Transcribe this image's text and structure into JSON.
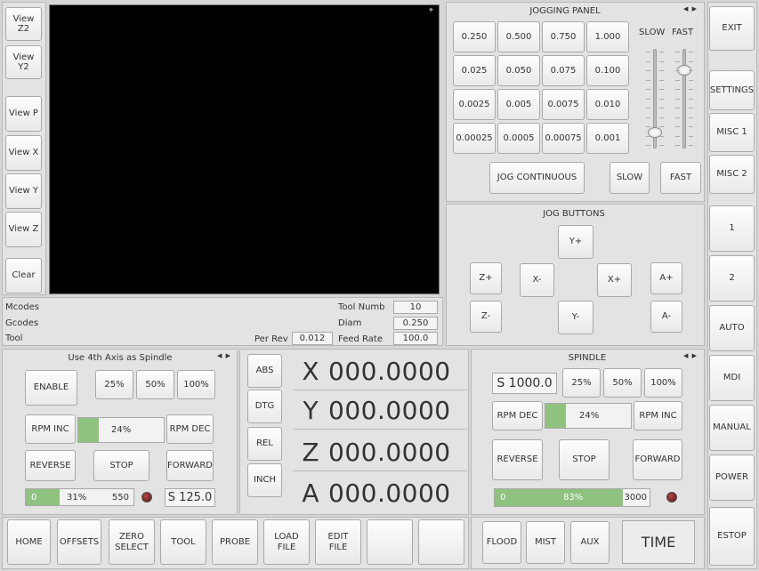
{
  "left_view_buttons": [
    "View Z2",
    "View Y2",
    "View P",
    "View X",
    "View Y",
    "View Z",
    "Clear"
  ],
  "info": {
    "mcodes_label": "Mcodes",
    "gcodes_label": "Gcodes",
    "tool_label": "Tool",
    "tool_numb_label": "Tool Numb",
    "tool_numb_value": "10",
    "diam_label": "Diam",
    "diam_value": "0.250",
    "per_rev_label": "Per Rev",
    "per_rev_value": "0.012",
    "feed_rate_label": "Feed Rate",
    "feed_rate_value": "100.0"
  },
  "jogging_panel": {
    "title": "JOGGING PANEL",
    "increments": [
      [
        "0.250",
        "0.500",
        "0.750",
        "1.000"
      ],
      [
        "0.025",
        "0.050",
        "0.075",
        "0.100"
      ],
      [
        "0.0025",
        "0.005",
        "0.0075",
        "0.010"
      ],
      [
        "0.00025",
        "0.0005",
        "0.00075",
        "0.001"
      ]
    ],
    "slow_label": "SLOW",
    "fast_label": "FAST",
    "slow_slider_level": 0.12,
    "fast_slider_level": 0.82,
    "jog_continuous": "JOG CONTINUOUS",
    "slow_btn": "SLOW",
    "fast_btn": "FAST"
  },
  "jog_buttons": {
    "title": "JOG BUTTONS",
    "y_plus": "Y+",
    "z_plus": "Z+",
    "x_minus": "X-",
    "x_plus": "X+",
    "a_plus": "A+",
    "z_minus": "Z-",
    "y_minus": "Y-",
    "a_minus": "A-"
  },
  "right_buttons": {
    "exit": "EXIT",
    "settings": "SETTINGS",
    "misc1": "MISC 1",
    "misc2": "MISC 2",
    "one": "1",
    "two": "2",
    "auto": "AUTO",
    "mdi": "MDI",
    "manual": "MANUAL",
    "power": "POWER",
    "estop": "ESTOP"
  },
  "fourth_axis": {
    "title": "Use 4th Axis as Spindle",
    "enable": "ENABLE",
    "p25": "25%",
    "p50": "50%",
    "p100": "100%",
    "rpm_inc": "RPM INC",
    "rpm_dec": "RPM DEC",
    "override_pct": "24%",
    "override_level": 0.24,
    "reverse": "REVERSE",
    "stop": "STOP",
    "forward": "FORWARD",
    "bar_min": "0",
    "bar_pct": "31%",
    "bar_level": 0.31,
    "bar_max": "550",
    "speed": "S 125.0"
  },
  "dro_mode_buttons": [
    "ABS",
    "DTG",
    "REL",
    "INCH"
  ],
  "dro": [
    {
      "axis": "X",
      "value": "000.0000"
    },
    {
      "axis": "Y",
      "value": "000.0000"
    },
    {
      "axis": "Z",
      "value": "000.0000"
    },
    {
      "axis": "A",
      "value": "000.0000"
    }
  ],
  "spindle": {
    "title": "SPINDLE",
    "speed": "S 1000.0",
    "p25": "25%",
    "p50": "50%",
    "p100": "100%",
    "rpm_dec": "RPM DEC",
    "rpm_inc": "RPM INC",
    "override_pct": "24%",
    "override_level": 0.24,
    "reverse": "REVERSE",
    "stop": "STOP",
    "forward": "FORWARD",
    "bar_min": "0",
    "bar_pct": "83%",
    "bar_level": 0.83,
    "bar_max": "3000"
  },
  "bottom_buttons": [
    "HOME",
    "OFFSETS",
    "ZERO\nSELECT",
    "TOOL",
    "PROBE",
    "LOAD\nFILE",
    "EDIT\nFILE",
    "",
    ""
  ],
  "coolant": {
    "flood": "FLOOD",
    "mist": "MIST",
    "aux": "AUX",
    "time": "TIME"
  },
  "colors": {
    "preview_bg": "#000000",
    "bar_fill": "#8fc17f",
    "led_off": "#6b1414"
  }
}
